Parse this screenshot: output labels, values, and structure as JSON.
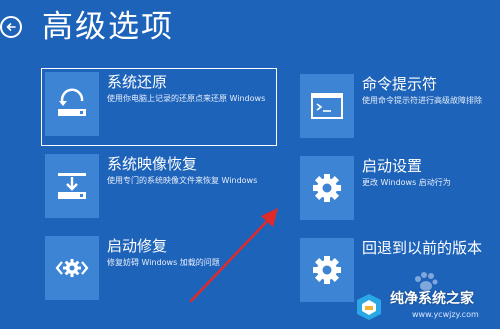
{
  "page": {
    "title": "高级选项"
  },
  "options": [
    {
      "title": "系统还原",
      "description": "使用你电脑上记录的还原点来还原 Windows",
      "icon": "system-restore-icon",
      "selected": true
    },
    {
      "title": "命令提示符",
      "description": "使用命令提示符进行高级故障排除",
      "icon": "command-prompt-icon",
      "selected": false
    },
    {
      "title": "系统映像恢复",
      "description": "使用专门的系统映像文件来恢复 Windows",
      "icon": "system-image-recovery-icon",
      "selected": false
    },
    {
      "title": "启动设置",
      "description": "更改 Windows 启动行为",
      "icon": "gear-icon",
      "selected": false
    },
    {
      "title": "启动修复",
      "description": "修复妨碍 Windows 加载的问题",
      "icon": "startup-repair-icon",
      "selected": false
    },
    {
      "title": "回退到以前的版本",
      "description": "",
      "icon": "gear-icon",
      "selected": false
    }
  ],
  "watermark": {
    "title": "纯净系统之家",
    "url": "www.ycwjzy.com"
  },
  "colors": {
    "background": "#1e63ba",
    "tile": "#3d84d4",
    "text": "#ffffff",
    "arrow": "#e02a2a"
  }
}
